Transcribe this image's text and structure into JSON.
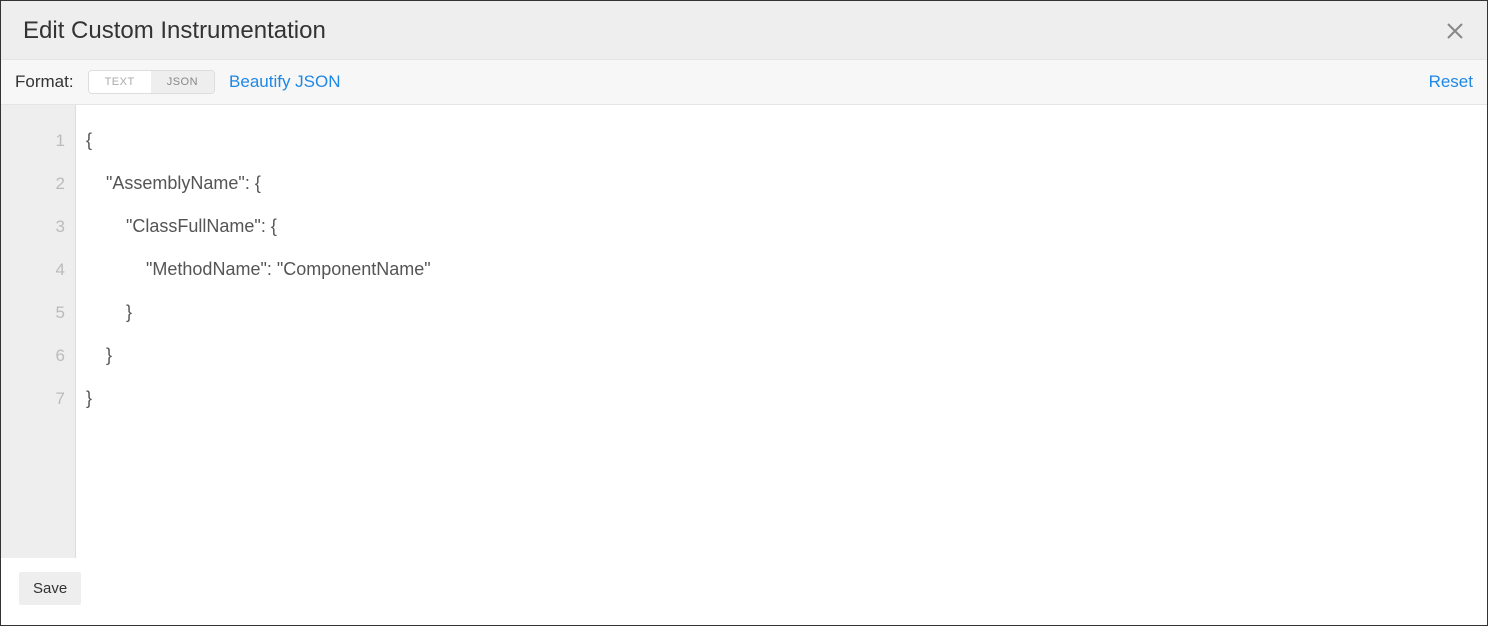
{
  "dialog": {
    "title": "Edit Custom Instrumentation"
  },
  "toolbar": {
    "format_label": "Format:",
    "toggle_text": "TEXT",
    "toggle_json": "JSON",
    "beautify": "Beautify JSON",
    "reset": "Reset"
  },
  "editor": {
    "line_numbers": [
      "1",
      "2",
      "3",
      "4",
      "5",
      "6",
      "7"
    ],
    "lines": [
      "{",
      "    \"AssemblyName\": {",
      "        \"ClassFullName\": {",
      "            \"MethodName\": \"ComponentName\"",
      "        }",
      "    }",
      "}"
    ]
  },
  "footer": {
    "save": "Save"
  }
}
